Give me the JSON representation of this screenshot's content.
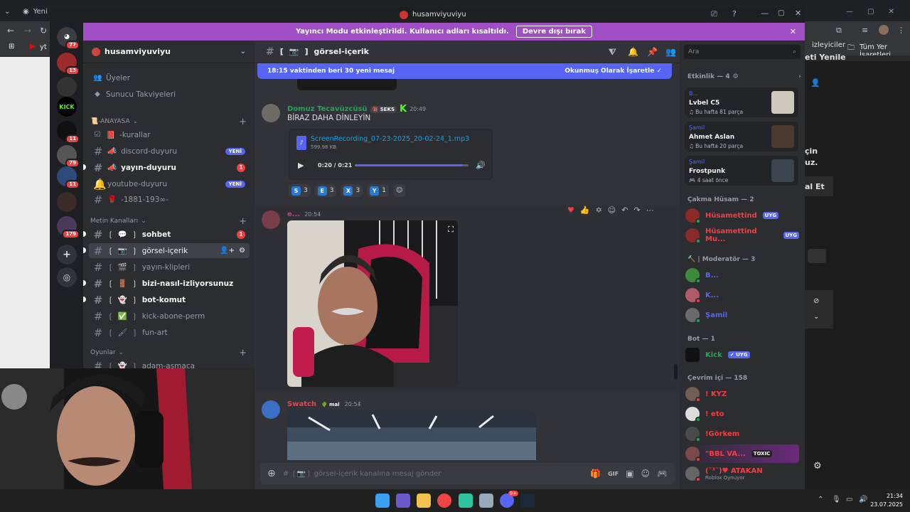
{
  "browser": {
    "tab1": "Yeni Se",
    "bookmark_all": "Tüm Yer İşaretleri",
    "yt": "yt",
    "right_texts": [
      "izleyiciler",
      "eti Yenile",
      "çin",
      "uz.",
      "al Et"
    ]
  },
  "window": {
    "title": "husamviyuviyu"
  },
  "streamer_bar": {
    "text": "Yayıncı Modu etkinleştirildi. Kullanıcı adları kısaltıldı.",
    "button": "Devre dışı bırak"
  },
  "guild_badges": [
    "77",
    "13",
    "11",
    "79",
    "11",
    "179"
  ],
  "guild_kick_label": "KICK",
  "server": {
    "name": "husamviyuviyu"
  },
  "channels_top": [
    {
      "label": "Üyeler",
      "icon": "members-icon"
    },
    {
      "label": "Sunucu Takviyeleri",
      "icon": "boost-icon"
    }
  ],
  "categories": {
    "anayasa": "📜-ANAYASA",
    "metin": "Metin Kanalları",
    "oyunlar": "Oyunlar"
  },
  "channels_anayasa": [
    {
      "label": "-kurallar",
      "icon": "📕"
    },
    {
      "label": "discord-duyuru",
      "icon": "📣",
      "badge": "YENİ"
    },
    {
      "label": "yayın-duyuru",
      "icon": "📣",
      "badge": "1"
    },
    {
      "label": "youtube-duyuru",
      "icon": "📣",
      "badge": "YENİ"
    },
    {
      "label": "-1881-193∞-",
      "icon": "🌹"
    }
  ],
  "channels_metin": [
    {
      "label": "sohbet",
      "icon": "💬",
      "badge": "1"
    },
    {
      "label": "görsel-içerik",
      "icon": "📷"
    },
    {
      "label": "yayın-klipleri",
      "icon": "🎬"
    },
    {
      "label": "bizi-nasıl-izliyorsunuz",
      "icon": "🚪"
    },
    {
      "label": "bot-komut",
      "icon": "👻"
    },
    {
      "label": "kick-abone-perm",
      "icon": "✅"
    },
    {
      "label": "fun-art",
      "icon": "🖌"
    }
  ],
  "channels_oyunlar": [
    {
      "label": "adam-asmaca",
      "icon": "👻"
    }
  ],
  "chat": {
    "channel_name": "görsel-içerik",
    "channel_prefix": "[",
    "channel_suffix": "]",
    "channel_icon": "📷",
    "new_messages": "18:15 vaktinden beri 30 yeni mesaj",
    "mark_read": "Okunmuş Olarak İşaretle",
    "search_placeholder": "Ara",
    "composer_placeholder": "# ❲📷❳ görsel-içerik kanalına mesaj gönder"
  },
  "messages": [
    {
      "author": "Domuz Tecavüzcüsü",
      "author_color": "#23a55a",
      "tag": "SEKS",
      "time": "20:49",
      "text": "BİRAZ DAHA DİNLEYİN",
      "file": {
        "name": "ScreenRecording_07-23-2025_20-02-24_1.mp3",
        "size": "599.98 KB",
        "time": "0:20 / 0:21",
        "progress": 0.95
      },
      "reactions": [
        {
          "letter": "S",
          "count": "3"
        },
        {
          "letter": "E",
          "count": "3"
        },
        {
          "letter": "X",
          "count": "3"
        },
        {
          "letter": "Y",
          "count": "1"
        }
      ]
    },
    {
      "author": "e...",
      "author_color": "#c9436b",
      "time": "20:54"
    },
    {
      "author": "Swatch",
      "author_color": "#d94a5c",
      "tag": "mal",
      "time": "20:54"
    }
  ],
  "members": {
    "activity_head": "Etkinlik — 4",
    "activities": [
      {
        "user": "B...",
        "title": "Lvbel C5",
        "sub": "Bu hafta 81 parça"
      },
      {
        "user": "Şamil",
        "title": "Ahmet Aslan",
        "sub": "Bu hafta 20 parça"
      },
      {
        "user": "Şamil",
        "title": "Frostpunk",
        "sub": "4 saat önce"
      }
    ],
    "groups": [
      {
        "head": "Çakma Hüsam — 2",
        "items": [
          {
            "name": "Hüsamettind",
            "color": "#f23f43",
            "tag": "UYG"
          },
          {
            "name": "Hüsamettind Mu...",
            "color": "#f23f43",
            "tag": "UYG"
          }
        ]
      },
      {
        "head": "🔨 | Moderatör — 3",
        "items": [
          {
            "name": "B...",
            "color": "#5865f2"
          },
          {
            "name": "K...",
            "color": "#5865f2"
          },
          {
            "name": "Şamil",
            "color": "#5865f2"
          }
        ]
      },
      {
        "head": "Bot — 1",
        "items": [
          {
            "name": "Kick",
            "color": "#23a55a",
            "tag": "✔ UYG"
          }
        ]
      },
      {
        "head": "Çevrim içi — 158",
        "items": [
          {
            "name": "! KYZ",
            "color": "#f23f43"
          },
          {
            "name": "! eto",
            "color": "#f23f43"
          },
          {
            "name": "!Görkem",
            "color": "#f23f43"
          },
          {
            "name": "\"BBL VA...",
            "color": "#f23f43",
            "tag": "TOXIC"
          },
          {
            "name": "(¯³¯)♥ ATAKAN",
            "color": "#f23f43",
            "sub": "Roblox Oynuyor"
          }
        ]
      }
    ]
  },
  "taskbar": {
    "time": "21:34",
    "date": "23.07.2025",
    "discord_badge": "9+"
  }
}
